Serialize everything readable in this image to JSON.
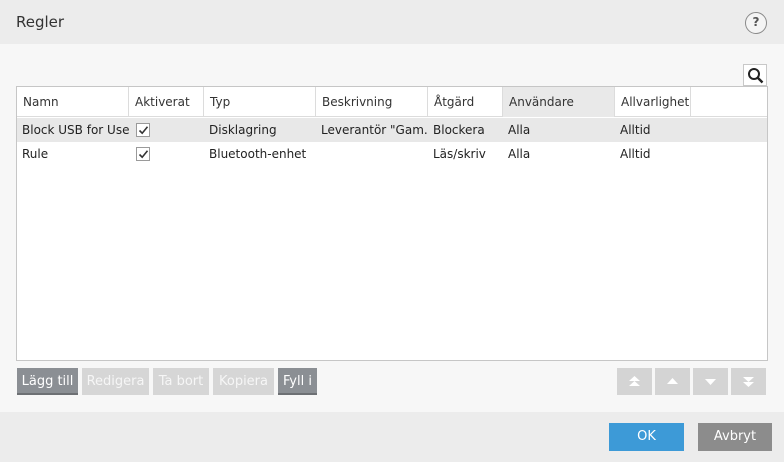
{
  "window": {
    "title": "Regler",
    "help_label": "?"
  },
  "search": {
    "icon": "search-icon"
  },
  "table": {
    "columns": [
      "Namn",
      "Aktiverat",
      "Typ",
      "Beskrivning",
      "Åtgärd",
      "Användare",
      "Allvarlighet"
    ],
    "sorted_column": "Användare",
    "rows": [
      {
        "name": "Block USB for User",
        "enabled": true,
        "type": "Disklagring",
        "description": "Leverantör \"Gam...",
        "action": "Blockera",
        "users": "Alla",
        "severity": "Alltid",
        "selected": true
      },
      {
        "name": "Rule",
        "enabled": true,
        "type": "Bluetooth-enhet",
        "description": "",
        "action": "Läs/skriv",
        "users": "Alla",
        "severity": "Alltid",
        "selected": false
      }
    ]
  },
  "toolbar": {
    "add": "Lägg till",
    "edit": "Redigera",
    "remove": "Ta bort",
    "copy": "Kopiera",
    "fill": "Fyll i",
    "move_icons": [
      "move-to-top-icon",
      "move-up-icon",
      "move-down-icon",
      "move-to-bottom-icon"
    ]
  },
  "footer": {
    "ok": "OK",
    "cancel": "Avbryt"
  },
  "colors": {
    "primary": "#3d9ad7",
    "active_button": "#8b8f94",
    "disabled_button": "#d6d6d6",
    "cancel_button": "#8c8c8c"
  }
}
